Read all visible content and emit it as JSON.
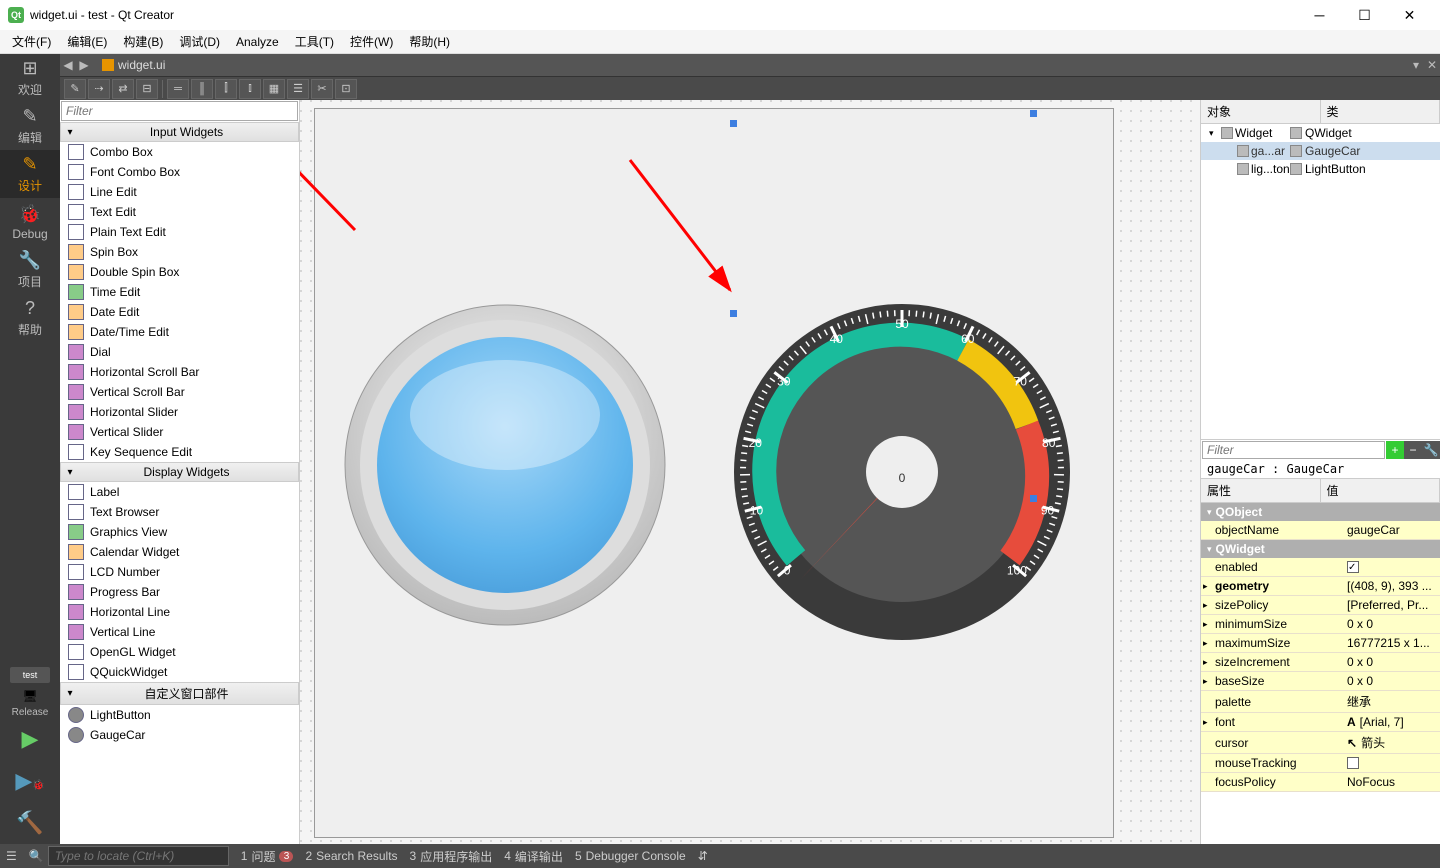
{
  "title": "widget.ui - test - Qt Creator",
  "menu": [
    "文件(F)",
    "编辑(E)",
    "构建(B)",
    "调试(D)",
    "Analyze",
    "工具(T)",
    "控件(W)",
    "帮助(H)"
  ],
  "leftbar": [
    {
      "icon": "⊞",
      "label": "欢迎"
    },
    {
      "icon": "✎",
      "label": "编辑"
    },
    {
      "icon": "✎",
      "label": "设计",
      "active": true
    },
    {
      "icon": "🐞",
      "label": "Debug"
    },
    {
      "icon": "🔧",
      "label": "项目"
    },
    {
      "icon": "?",
      "label": "帮助"
    }
  ],
  "build": {
    "target": "test",
    "config": "Release"
  },
  "tab": {
    "file": "widget.ui"
  },
  "widgetbox": {
    "filter_placeholder": "Filter",
    "groups": [
      {
        "title": "Input Widgets",
        "items": [
          {
            "icon": "cb",
            "label": "Combo Box"
          },
          {
            "icon": "cb",
            "label": "Font Combo Box"
          },
          {
            "icon": "ai",
            "label": "Line Edit"
          },
          {
            "icon": "ai",
            "label": "Text Edit"
          },
          {
            "icon": "ai",
            "label": "Plain Text Edit"
          },
          {
            "icon": "de",
            "label": "Spin Box"
          },
          {
            "icon": "de",
            "label": "Double Spin Box"
          },
          {
            "icon": "tm",
            "label": "Time Edit"
          },
          {
            "icon": "de",
            "label": "Date Edit"
          },
          {
            "icon": "de",
            "label": "Date/Time Edit"
          },
          {
            "icon": "sl",
            "label": "Dial"
          },
          {
            "icon": "sl",
            "label": "Horizontal Scroll Bar"
          },
          {
            "icon": "sl",
            "label": "Vertical Scroll Bar"
          },
          {
            "icon": "sl",
            "label": "Horizontal Slider"
          },
          {
            "icon": "sl",
            "label": "Vertical Slider"
          },
          {
            "icon": "ai",
            "label": "Key Sequence Edit"
          }
        ]
      },
      {
        "title": "Display Widgets",
        "items": [
          {
            "icon": "cb",
            "label": "Label"
          },
          {
            "icon": "ai",
            "label": "Text Browser"
          },
          {
            "icon": "tm",
            "label": "Graphics View"
          },
          {
            "icon": "de",
            "label": "Calendar Widget"
          },
          {
            "icon": "ai",
            "label": "LCD Number"
          },
          {
            "icon": "sl",
            "label": "Progress Bar"
          },
          {
            "icon": "sl",
            "label": "Horizontal Line"
          },
          {
            "icon": "sl",
            "label": "Vertical Line"
          },
          {
            "icon": "cb",
            "label": "OpenGL Widget"
          },
          {
            "icon": "cb",
            "label": "QQuickWidget"
          }
        ]
      },
      {
        "title": "自定义窗口部件",
        "items": [
          {
            "icon": "lg",
            "label": "LightButton"
          },
          {
            "icon": "lg",
            "label": "GaugeCar"
          }
        ]
      }
    ]
  },
  "objectTree": {
    "head": [
      "对象",
      "类"
    ],
    "rows": [
      {
        "indent": 0,
        "name": "Widget",
        "cls": "QWidget",
        "arr": "▾"
      },
      {
        "indent": 1,
        "name": "ga...ar",
        "cls": "GaugeCar",
        "sel": true
      },
      {
        "indent": 1,
        "name": "lig...ton",
        "cls": "LightButton"
      }
    ]
  },
  "propPanel": {
    "filter_placeholder": "Filter",
    "classLine": "gaugeCar : GaugeCar",
    "head": [
      "属性",
      "值"
    ],
    "groups": [
      {
        "name": "QObject",
        "rows": [
          {
            "k": "objectName",
            "v": "gaugeCar",
            "y": true
          }
        ]
      },
      {
        "name": "QWidget",
        "rows": [
          {
            "k": "enabled",
            "v": "",
            "chk": true,
            "y": true
          },
          {
            "k": "geometry",
            "v": "[(408, 9), 393 ...",
            "y": true,
            "exp": true,
            "bold": true
          },
          {
            "k": "sizePolicy",
            "v": "[Preferred, Pr...",
            "y": true,
            "exp": true
          },
          {
            "k": "minimumSize",
            "v": "0 x 0",
            "y": true,
            "exp": true
          },
          {
            "k": "maximumSize",
            "v": "16777215 x 1...",
            "y": true,
            "exp": true
          },
          {
            "k": "sizeIncrement",
            "v": "0 x 0",
            "y": true,
            "exp": true
          },
          {
            "k": "baseSize",
            "v": "0 x 0",
            "y": true,
            "exp": true
          },
          {
            "k": "palette",
            "v": "继承",
            "y": true
          },
          {
            "k": "font",
            "v": "[Arial, 7]",
            "y": true,
            "exp": true,
            "icon": "A"
          },
          {
            "k": "cursor",
            "v": "箭头",
            "y": true,
            "icon": "↖"
          },
          {
            "k": "mouseTracking",
            "v": "",
            "chk": false,
            "y": true
          },
          {
            "k": "focusPolicy",
            "v": "NoFocus",
            "y": true
          }
        ]
      }
    ]
  },
  "status": {
    "locate_placeholder": "Type to locate (Ctrl+K)",
    "items": [
      {
        "n": "1",
        "label": "问题",
        "badge": "3"
      },
      {
        "n": "2",
        "label": "Search Results"
      },
      {
        "n": "3",
        "label": "应用程序输出"
      },
      {
        "n": "4",
        "label": "编译输出"
      },
      {
        "n": "5",
        "label": "Debugger Console"
      }
    ]
  },
  "gauge": {
    "value": "0",
    "min": 0,
    "max": 100,
    "ticks": [
      0,
      10,
      20,
      30,
      40,
      50,
      60,
      70,
      80,
      90,
      100
    ]
  }
}
